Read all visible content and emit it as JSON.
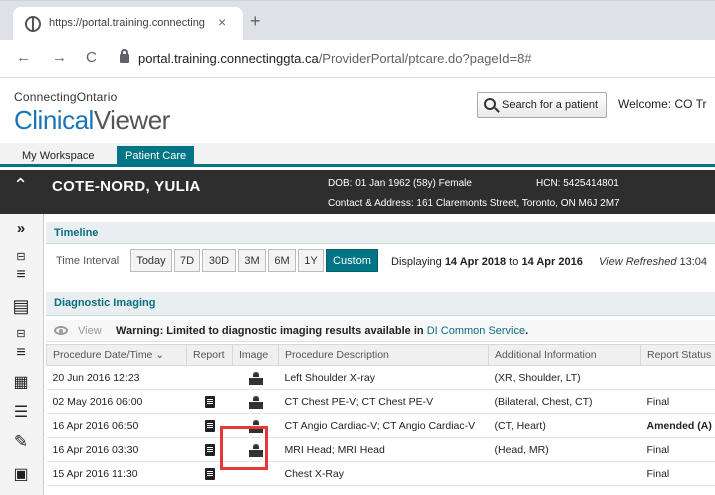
{
  "browser": {
    "tab_title": "https://portal.training.connecting",
    "tab_close": "×",
    "new_tab": "+",
    "back": "←",
    "forward": "→",
    "reload": "C",
    "url_host": "portal.training.connectinggta.ca",
    "url_path": "/ProviderPortal/ptcare.do?pageId=8#"
  },
  "app": {
    "brand_top": "ConnectingOntario",
    "brand_clinical": "Clinical",
    "brand_viewer": "Viewer",
    "search_label": "Search for a patient",
    "welcome": "Welcome: CO Tr"
  },
  "tabs": [
    {
      "label": "My Workspace"
    },
    {
      "label": "Patient Care"
    }
  ],
  "patient": {
    "name": "COTE-NORD, YULIA",
    "dob": "DOB: 01 Jan 1962 (58y) Female",
    "hcn": "HCN: 5425414801",
    "address": "Contact & Address: 161 Claremonts Street, Toronto, ON M6J 2M7"
  },
  "timeline": {
    "title": "Timeline",
    "interval_label": "Time Interval",
    "buttons": [
      "Today",
      "7D",
      "30D",
      "3M",
      "6M",
      "1Y",
      "Custom"
    ],
    "displaying_prefix": "Displaying",
    "from": "14 Apr 2018",
    "to_word": "to",
    "to": "14 Apr 2016",
    "refreshed_label": "View Refreshed",
    "refreshed_time": "13:04"
  },
  "di": {
    "title": "Diagnostic Imaging",
    "view": "View",
    "warning": "Warning: Limited to diagnostic imaging results available in",
    "warning_link": "DI Common Service",
    "warning_end": ".",
    "columns": [
      "Procedure Date/Time ⌄",
      "Report",
      "Image",
      "Procedure Description",
      "Additional Information",
      "Report Status"
    ],
    "rows": [
      {
        "date": "20 Jun 2016 12:23",
        "report": false,
        "image": true,
        "desc": "Left Shoulder X-ray",
        "info": "(XR, Shoulder, LT)",
        "status": ""
      },
      {
        "date": "02 May 2016 06:00",
        "report": true,
        "image": true,
        "desc": "CT Chest PE-V; CT Chest PE-V",
        "info": "(Bilateral, Chest, CT)",
        "status": "Final"
      },
      {
        "date": "16 Apr 2016 06:50",
        "report": true,
        "image": true,
        "desc": "CT Angio Cardiac-V; CT Angio Cardiac-V",
        "info": "(CT, Heart)",
        "status": "Amended (A)"
      },
      {
        "date": "16 Apr 2016 03:30",
        "report": true,
        "image": true,
        "desc": "MRI Head; MRI Head",
        "info": "(Head, MR)",
        "status": "Final"
      },
      {
        "date": "15 Apr 2016 11:30",
        "report": true,
        "image": false,
        "desc": "Chest X-Ray",
        "info": "",
        "status": "Final"
      }
    ]
  }
}
